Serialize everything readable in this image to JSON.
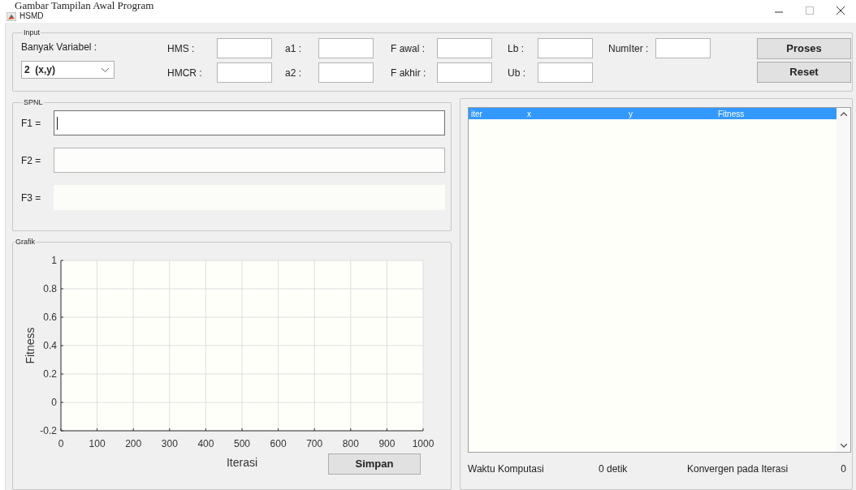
{
  "caption": "Gambar Tampilan Awal Program",
  "window": {
    "title": "HSMD"
  },
  "input": {
    "title": "Input",
    "variable_count": {
      "label": "Banyak Variabel :",
      "value": "2  (x,y)"
    },
    "parameter_columns": [
      {
        "fields": [
          {
            "label": "HMS :"
          },
          {
            "label": "HMCR :"
          }
        ]
      },
      {
        "fields": [
          {
            "label": "a1 :"
          },
          {
            "label": "a2 :"
          }
        ]
      },
      {
        "fields": [
          {
            "label": "F awal :"
          },
          {
            "label": "F akhir :"
          }
        ]
      },
      {
        "fields": [
          {
            "label": "Lb :"
          },
          {
            "label": "Ub :"
          }
        ]
      },
      {
        "fields": [
          {
            "label": "NumIter :"
          }
        ]
      }
    ],
    "buttons": [
      "Proses",
      "Reset"
    ]
  },
  "spnl": {
    "title": "SPNL",
    "equations": [
      {
        "label": "F1 =",
        "focused": true,
        "disabled": false
      },
      {
        "label": "F2 =",
        "focused": false,
        "disabled": false
      },
      {
        "label": "F3 =",
        "focused": false,
        "disabled": true
      }
    ]
  },
  "grafik": {
    "title": "Grafik",
    "chart_data": {
      "type": "line",
      "xlabel": "Iterasi",
      "ylabel": "Fitness",
      "xlim": [
        0,
        1000
      ],
      "ylim": [
        -0.2,
        1
      ],
      "xticks": [
        0,
        100,
        200,
        300,
        400,
        500,
        600,
        700,
        800,
        900,
        1000
      ],
      "yticks": [
        -0.2,
        0,
        0.2,
        0.4,
        0.6,
        0.8,
        1
      ],
      "grid": true
    },
    "save_button": "Simpan"
  },
  "results": {
    "rows": [
      {
        "cells": [
          "iter",
          "x",
          "y",
          "Fitness"
        ],
        "selected": true
      }
    ],
    "status": [
      {
        "label": "Waktu Komputasi",
        "value": "0 detik"
      },
      {
        "label": "Konvergen pada Iterasi",
        "value": "0"
      }
    ]
  }
}
